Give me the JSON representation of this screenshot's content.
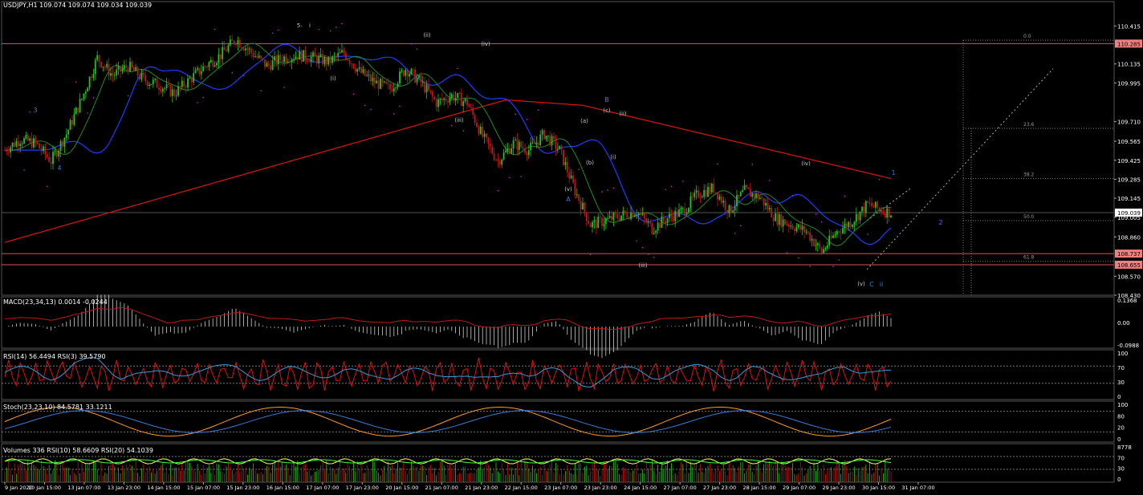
{
  "symbol_header": "USDJPY,H1  109.074 109.074 109.034 109.039",
  "colors": {
    "background": "#000000",
    "grid": "#2a2a2a",
    "bull_candle": "#22c322",
    "bear_candle": "#c01818",
    "ma_red": "#e01010",
    "ma_blue": "#1e3cff",
    "ma_green": "#228b22",
    "dots": "#d020d0",
    "hline": "#e05050",
    "fib": "#808080",
    "wave_white": "#c8c8c8",
    "wave_blue": "#3a7bd5",
    "current_price_bg": "#ffffff",
    "level_tag_bg": "#f08080"
  },
  "price_axis": {
    "ticks": [
      "110.415",
      "110.135",
      "109.995",
      "109.710",
      "109.565",
      "109.425",
      "109.285",
      "109.145",
      "109.005",
      "108.860",
      "108.570",
      "108.430"
    ],
    "current_price_tag": "109.039",
    "level_tags": [
      "110.285",
      "108.737",
      "108.655"
    ]
  },
  "fib_labels": [
    "0.0",
    "23.6",
    "38.2",
    "50.0",
    "61.8"
  ],
  "wave_labels_white": [
    "5",
    "i",
    "(i)",
    "(ii)",
    "(iii)",
    "(iv)",
    "(v)",
    "(a)",
    "(b)",
    "(c)",
    "(i)",
    "(ii)",
    "(iii)",
    "(iv)",
    "(v)"
  ],
  "wave_labels_blue": [
    "3",
    "4",
    "A",
    "B",
    "C",
    "ii",
    "1",
    "2"
  ],
  "time_axis": [
    "9 Jan 2020",
    "10 Jan 15:00",
    "13 Jan 07:00",
    "13 Jan 23:00",
    "14 Jan 15:00",
    "15 Jan 07:00",
    "15 Jan 23:00",
    "16 Jan 15:00",
    "17 Jan 07:00",
    "17 Jan 23:00",
    "20 Jan 15:00",
    "21 Jan 07:00",
    "21 Jan 23:00",
    "22 Jan 15:00",
    "23 Jan 07:00",
    "23 Jan 23:00",
    "24 Jan 15:00",
    "27 Jan 07:00",
    "27 Jan 23:00",
    "28 Jan 15:00",
    "29 Jan 07:00",
    "29 Jan 23:00",
    "30 Jan 15:00",
    "31 Jan 07:00"
  ],
  "panels": {
    "macd": {
      "title": "MACD(23,34,13) 0.0014 -0.0244",
      "ticks": [
        "0.1368",
        "0.00",
        "-0.0988"
      ]
    },
    "rsi": {
      "title": "RSI(14) 56.4494  RSI(3) 39.5790",
      "ticks": [
        "100",
        "70",
        "30",
        "0"
      ]
    },
    "stoch": {
      "title": "Stoch(23,23,10) 84.5781 33.1211",
      "ticks": [
        "100",
        "80",
        "20",
        "0"
      ]
    },
    "volumes": {
      "title": "Volumes 336  RSI(10) 58.6609  RSI(20) 54.1039",
      "ticks": [
        "8778",
        "70",
        "30",
        "0"
      ]
    }
  },
  "chart_data": {
    "type": "candlestick",
    "symbol": "USDJPY",
    "timeframe": "H1",
    "last_price": 109.039,
    "ylim": [
      108.43,
      110.5
    ],
    "x_start": "9 Jan 2020",
    "x_end": "31 Jan 07:00",
    "close_path": [
      [
        0,
        109.5
      ],
      [
        8,
        109.58
      ],
      [
        16,
        109.55
      ],
      [
        24,
        109.42
      ],
      [
        32,
        109.62
      ],
      [
        40,
        109.88
      ],
      [
        48,
        110.18
      ],
      [
        56,
        110.05
      ],
      [
        64,
        110.12
      ],
      [
        72,
        110.02
      ],
      [
        80,
        109.98
      ],
      [
        88,
        109.92
      ],
      [
        96,
        110.02
      ],
      [
        104,
        110.12
      ],
      [
        112,
        110.2
      ],
      [
        120,
        110.32
      ],
      [
        128,
        110.22
      ],
      [
        136,
        110.12
      ],
      [
        144,
        110.18
      ],
      [
        152,
        110.2
      ],
      [
        160,
        110.18
      ],
      [
        168,
        110.15
      ],
      [
        176,
        110.22
      ],
      [
        184,
        110.08
      ],
      [
        192,
        110.0
      ],
      [
        200,
        109.95
      ],
      [
        208,
        110.1
      ],
      [
        216,
        110.0
      ],
      [
        224,
        109.85
      ],
      [
        232,
        109.9
      ],
      [
        240,
        109.85
      ],
      [
        248,
        109.6
      ],
      [
        256,
        109.42
      ],
      [
        264,
        109.55
      ],
      [
        272,
        109.5
      ],
      [
        280,
        109.62
      ],
      [
        288,
        109.5
      ],
      [
        296,
        109.2
      ],
      [
        304,
        108.95
      ],
      [
        312,
        108.98
      ],
      [
        320,
        109.02
      ],
      [
        328,
        109.05
      ],
      [
        336,
        108.92
      ],
      [
        344,
        109.0
      ],
      [
        352,
        109.05
      ],
      [
        360,
        109.18
      ],
      [
        368,
        109.22
      ],
      [
        376,
        109.05
      ],
      [
        384,
        109.2
      ],
      [
        392,
        109.15
      ],
      [
        400,
        109.0
      ],
      [
        408,
        108.95
      ],
      [
        416,
        108.9
      ],
      [
        424,
        108.75
      ],
      [
        432,
        108.9
      ],
      [
        440,
        108.98
      ],
      [
        448,
        109.1
      ],
      [
        456,
        109.05
      ],
      [
        460,
        109.04
      ]
    ],
    "horizontal_levels": [
      110.285,
      108.737,
      108.655
    ],
    "fibonacci": [
      {
        "label": "0.0",
        "price": 110.31
      },
      {
        "label": "23.6",
        "price": 109.66
      },
      {
        "label": "38.2",
        "price": 109.29
      },
      {
        "label": "50.0",
        "price": 108.98
      },
      {
        "label": "61.8",
        "price": 108.68
      }
    ]
  }
}
